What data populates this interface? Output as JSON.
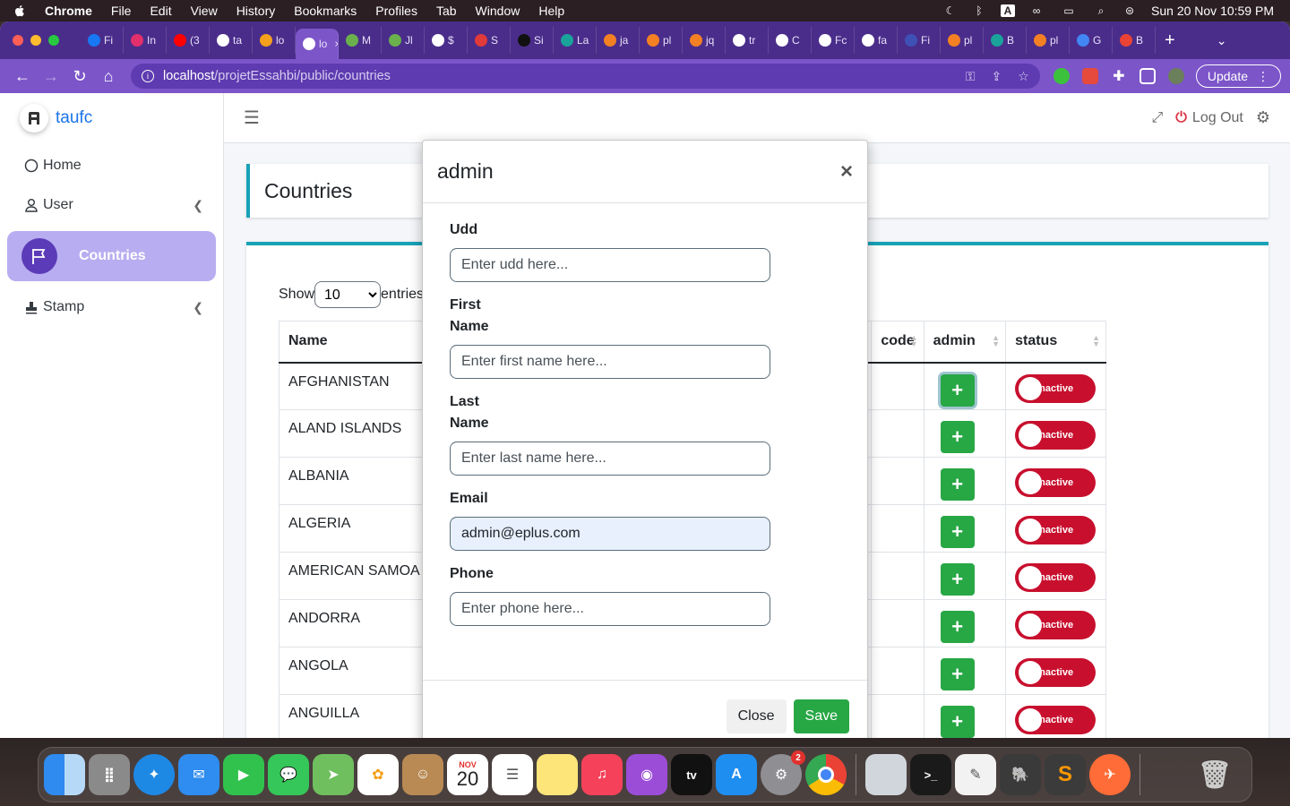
{
  "menubar": {
    "app": "Chrome",
    "items": [
      "File",
      "Edit",
      "View",
      "History",
      "Bookmarks",
      "Profiles",
      "Tab",
      "Window",
      "Help"
    ],
    "clock": "Sun 20 Nov  10:59 PM"
  },
  "browser": {
    "tabs": [
      {
        "label": "Fi",
        "color": "#1877f2"
      },
      {
        "label": "In",
        "color": "#e1306c"
      },
      {
        "label": "(3",
        "color": "#ff0000"
      },
      {
        "label": "ta",
        "color": "#ffffff"
      },
      {
        "label": "lo",
        "color": "#f4a01c"
      },
      {
        "label": "lo",
        "color": "#ffffff",
        "active": true
      },
      {
        "label": "M",
        "color": "#6ab04c"
      },
      {
        "label": "Jl",
        "color": "#6ab04c"
      },
      {
        "label": "$",
        "color": "#ffffff"
      },
      {
        "label": "S",
        "color": "#e03a3a"
      },
      {
        "label": "Si",
        "color": "#111111"
      },
      {
        "label": "La",
        "color": "#1aa39a"
      },
      {
        "label": "ja",
        "color": "#f48024"
      },
      {
        "label": "pl",
        "color": "#f48024"
      },
      {
        "label": "jq",
        "color": "#f48024"
      },
      {
        "label": "tr",
        "color": "#ffffff"
      },
      {
        "label": "C",
        "color": "#ffffff"
      },
      {
        "label": "Fc",
        "color": "#ffffff"
      },
      {
        "label": "fa",
        "color": "#ffffff"
      },
      {
        "label": "Fi",
        "color": "#3f51b5"
      },
      {
        "label": "pl",
        "color": "#f48024"
      },
      {
        "label": "B",
        "color": "#1aa39a"
      },
      {
        "label": "pl",
        "color": "#f48024"
      },
      {
        "label": "G",
        "color": "#4285f4"
      },
      {
        "label": "B",
        "color": "#ea4335"
      }
    ],
    "url_host": "localhost",
    "url_path": "/projetEssahbi/public/countries",
    "update_label": "Update"
  },
  "sidebar": {
    "brand": "taufc",
    "items": [
      {
        "label": "Home",
        "icon": "circle-icon"
      },
      {
        "label": "User",
        "icon": "user-icon",
        "chevron": true
      },
      {
        "label": "Countries",
        "icon": "flag-icon",
        "active": true
      },
      {
        "label": "Stamp",
        "icon": "stamp-icon",
        "chevron": true
      }
    ]
  },
  "topnav": {
    "logout": "Log Out"
  },
  "page": {
    "title": "Countries",
    "show_label": "Show",
    "entries_label": "entries",
    "page_length": "10",
    "columns": [
      "Name",
      "code",
      "admin",
      "status"
    ],
    "rows": [
      {
        "name": "AFGHANISTAN",
        "status": "Inactive"
      },
      {
        "name": "ALAND ISLANDS",
        "status": "Inactive"
      },
      {
        "name": "ALBANIA",
        "status": "Inactive"
      },
      {
        "name": "ALGERIA",
        "status": "Inactive"
      },
      {
        "name": "AMERICAN SAMOA",
        "status": "Inactive"
      },
      {
        "name": "ANDORRA",
        "status": "Inactive"
      },
      {
        "name": "ANGOLA",
        "status": "Inactive"
      },
      {
        "name": "ANGUILLA",
        "status": "Inactive"
      }
    ]
  },
  "modal": {
    "title": "admin",
    "fields": [
      {
        "label": "Udd",
        "placeholder": "Enter udd here...",
        "value": ""
      },
      {
        "label": "First Name",
        "placeholder": "Enter first name here...",
        "value": ""
      },
      {
        "label": "Last Name",
        "placeholder": "Enter last name here...",
        "value": ""
      },
      {
        "label": "Email",
        "placeholder": "",
        "value": "admin@eplus.com"
      },
      {
        "label": "Phone",
        "placeholder": "Enter phone here...",
        "value": ""
      }
    ],
    "close_label": "Close",
    "save_label": "Save"
  },
  "dock": {
    "calendar_month": "NOV",
    "calendar_day": "20",
    "settings_badge": "2"
  }
}
